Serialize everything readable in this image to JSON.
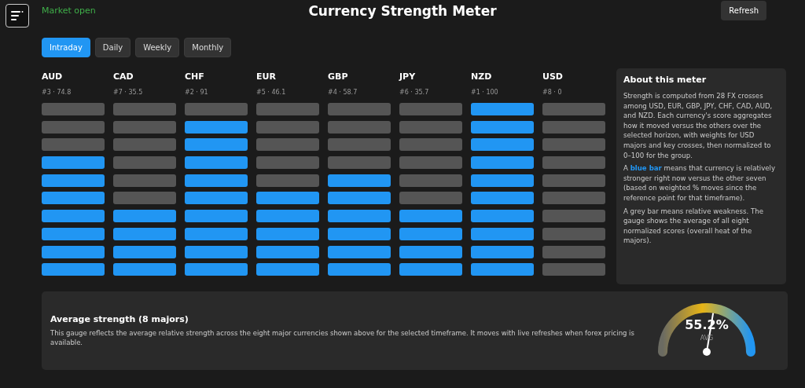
{
  "header": {
    "market_status": "Market open",
    "market_open": true,
    "title": "Currency Strength Meter",
    "refresh_button": "Refresh"
  },
  "tabs": [
    {
      "label": "Intraday",
      "selected": true
    },
    {
      "label": "Daily",
      "selected": false
    },
    {
      "label": "Weekly",
      "selected": false
    },
    {
      "label": "Monthly",
      "selected": false
    }
  ],
  "currencies": [
    {
      "code": "AUD",
      "rank_score": "#3 · 74.8",
      "bars": [
        {
          "filled": false
        },
        {
          "filled": false
        },
        {
          "filled": false
        },
        {
          "filled": true
        },
        {
          "filled": true
        },
        {
          "filled": true
        },
        {
          "filled": true
        },
        {
          "filled": true
        },
        {
          "filled": true
        },
        {
          "filled": true
        }
      ]
    },
    {
      "code": "CAD",
      "rank_score": "#7 · 35.5",
      "bars": [
        {
          "filled": false
        },
        {
          "filled": false
        },
        {
          "filled": false
        },
        {
          "filled": false
        },
        {
          "filled": false
        },
        {
          "filled": false
        },
        {
          "filled": true
        },
        {
          "filled": true
        },
        {
          "filled": true
        },
        {
          "filled": true
        }
      ]
    },
    {
      "code": "CHF",
      "rank_score": "#2 · 91",
      "bars": [
        {
          "filled": false
        },
        {
          "filled": true
        },
        {
          "filled": true
        },
        {
          "filled": true
        },
        {
          "filled": true
        },
        {
          "filled": true
        },
        {
          "filled": true
        },
        {
          "filled": true
        },
        {
          "filled": true
        },
        {
          "filled": true
        }
      ]
    },
    {
      "code": "EUR",
      "rank_score": "#5 · 46.1",
      "bars": [
        {
          "filled": false
        },
        {
          "filled": false
        },
        {
          "filled": false
        },
        {
          "filled": false
        },
        {
          "filled": false
        },
        {
          "filled": true
        },
        {
          "filled": true
        },
        {
          "filled": true
        },
        {
          "filled": true
        },
        {
          "filled": true
        }
      ]
    },
    {
      "code": "GBP",
      "rank_score": "#4 · 58.7",
      "bars": [
        {
          "filled": false
        },
        {
          "filled": false
        },
        {
          "filled": false
        },
        {
          "filled": false
        },
        {
          "filled": true
        },
        {
          "filled": true
        },
        {
          "filled": true
        },
        {
          "filled": true
        },
        {
          "filled": true
        },
        {
          "filled": true
        }
      ]
    },
    {
      "code": "JPY",
      "rank_score": "#6 · 35.7",
      "bars": [
        {
          "filled": false
        },
        {
          "filled": false
        },
        {
          "filled": false
        },
        {
          "filled": false
        },
        {
          "filled": false
        },
        {
          "filled": false
        },
        {
          "filled": true
        },
        {
          "filled": true
        },
        {
          "filled": true
        },
        {
          "filled": true
        }
      ]
    },
    {
      "code": "NZD",
      "rank_score": "#1 · 100",
      "bars": [
        {
          "filled": true
        },
        {
          "filled": true
        },
        {
          "filled": true
        },
        {
          "filled": true
        },
        {
          "filled": true
        },
        {
          "filled": true
        },
        {
          "filled": true
        },
        {
          "filled": true
        },
        {
          "filled": true
        },
        {
          "filled": true
        }
      ]
    },
    {
      "code": "USD",
      "rank_score": "#8 · 0",
      "bars": [
        {
          "filled": false
        },
        {
          "filled": false
        },
        {
          "filled": false
        },
        {
          "filled": false
        },
        {
          "filled": false
        },
        {
          "filled": false
        },
        {
          "filled": false
        },
        {
          "filled": false
        },
        {
          "filled": false
        },
        {
          "filled": false
        }
      ]
    }
  ],
  "about": {
    "title": "About this meter",
    "paragraphs": [
      "Strength is computed from 28 FX crosses among USD, EUR, GBP, JPY, CHF, CAD, AUD, and NZD. Each currency's score aggregates how it moved versus the others over the selected horizon, with weights for USD majors and key crosses, then normalized to 0–100 for the group.",
      "A **blue bar** means that currency is relatively stronger right now versus the other seven (based on weighted % moves since the reference point for that timeframe).",
      "A grey bar means relative weakness. The gauge shows the average of all eight normalized scores (overall heat of the majors)."
    ]
  },
  "average": {
    "title": "Average strength (8 majors)",
    "description": "This gauge reflects the average relative strength across the eight major currencies shown above for the selected timeframe. It moves with live refreshes when forex pricing is available.",
    "gauge_value": "55.2%",
    "gauge_label": "AVG"
  }
}
